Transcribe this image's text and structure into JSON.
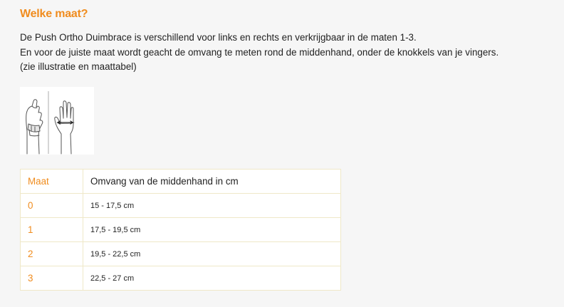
{
  "heading": "Welke maat?",
  "intro": {
    "line1": "De Push Ortho Duimbrace is verschillend voor links en rechts en verkrijgbaar in de maten 1-3.",
    "line2": "En voor de juiste maat wordt geacht de omvang te meten rond de middenhand, onder de knokkels van je vingers.",
    "line3": "(zie illustratie en maattabel)"
  },
  "size_table": {
    "headers": [
      "Maat",
      "Omvang van de middenhand in cm"
    ],
    "rows": [
      {
        "maat": "0",
        "omvang": "15 - 17,5 cm"
      },
      {
        "maat": "1",
        "omvang": "17,5 - 19,5 cm"
      },
      {
        "maat": "2",
        "omvang": "19,5 - 22,5 cm"
      },
      {
        "maat": "3",
        "omvang": " 22,5 - 27 cm"
      }
    ]
  },
  "colors": {
    "accent": "#f08c1e",
    "table_border": "#efe8c8",
    "background": "#f6f6f6"
  }
}
